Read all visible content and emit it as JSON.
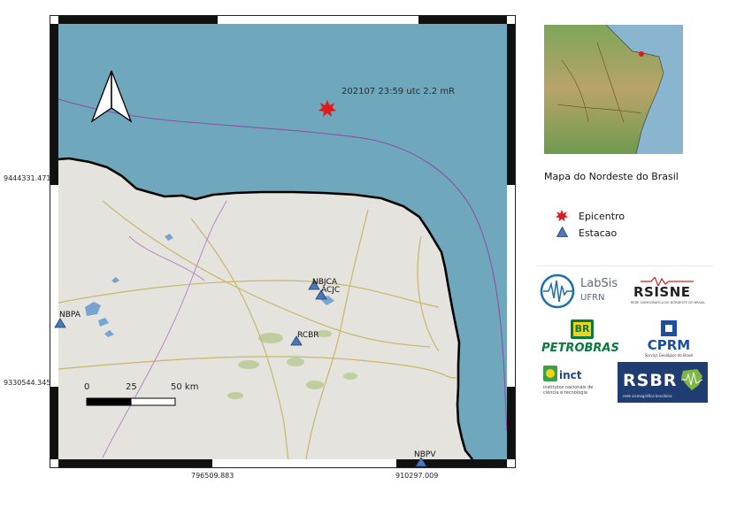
{
  "map": {
    "event_label": "202107 23:59 utc 2.2 mR",
    "coords": {
      "y_top": "9444331.471",
      "y_bottom": "9330544.345",
      "x_left": "796509.883",
      "x_right": "910297.009"
    },
    "stations": [
      "NBPA",
      "NBJCA",
      "ACJC",
      "RCBR",
      "NBPV"
    ],
    "scale_bar": {
      "labels": [
        "0",
        "25",
        "50 km"
      ]
    },
    "colors": {
      "sea": "#6fa8bd",
      "land": "#e4e3de",
      "coast": "#000000",
      "eez": "#8a4fa8",
      "station": "#4a78b8",
      "epicenter": "#e01b1b"
    }
  },
  "inset": {
    "caption": "Mapa do Nordeste do Brasil"
  },
  "legend": {
    "epicenter_label": "Epicentro",
    "station_label": "Estacao"
  },
  "logos": {
    "labsis": {
      "name": "LabSis",
      "sub": "UFRN"
    },
    "rsisne": {
      "name": "RSISNE",
      "sub": "REDE SISMOGRÁFICA DO NORDESTE DO BRASIL"
    },
    "petrobras": {
      "badge": "BR",
      "name": "PETROBRAS"
    },
    "cprm": {
      "name": "CPRM",
      "sub": "Serviço Geológico do Brasil"
    },
    "inct": {
      "name": "inct",
      "sub": "institutos nacionais de ciência e tecnologia"
    },
    "rsbr": {
      "name": "RSBR",
      "sub": "rede sismográfica brasileira"
    }
  }
}
